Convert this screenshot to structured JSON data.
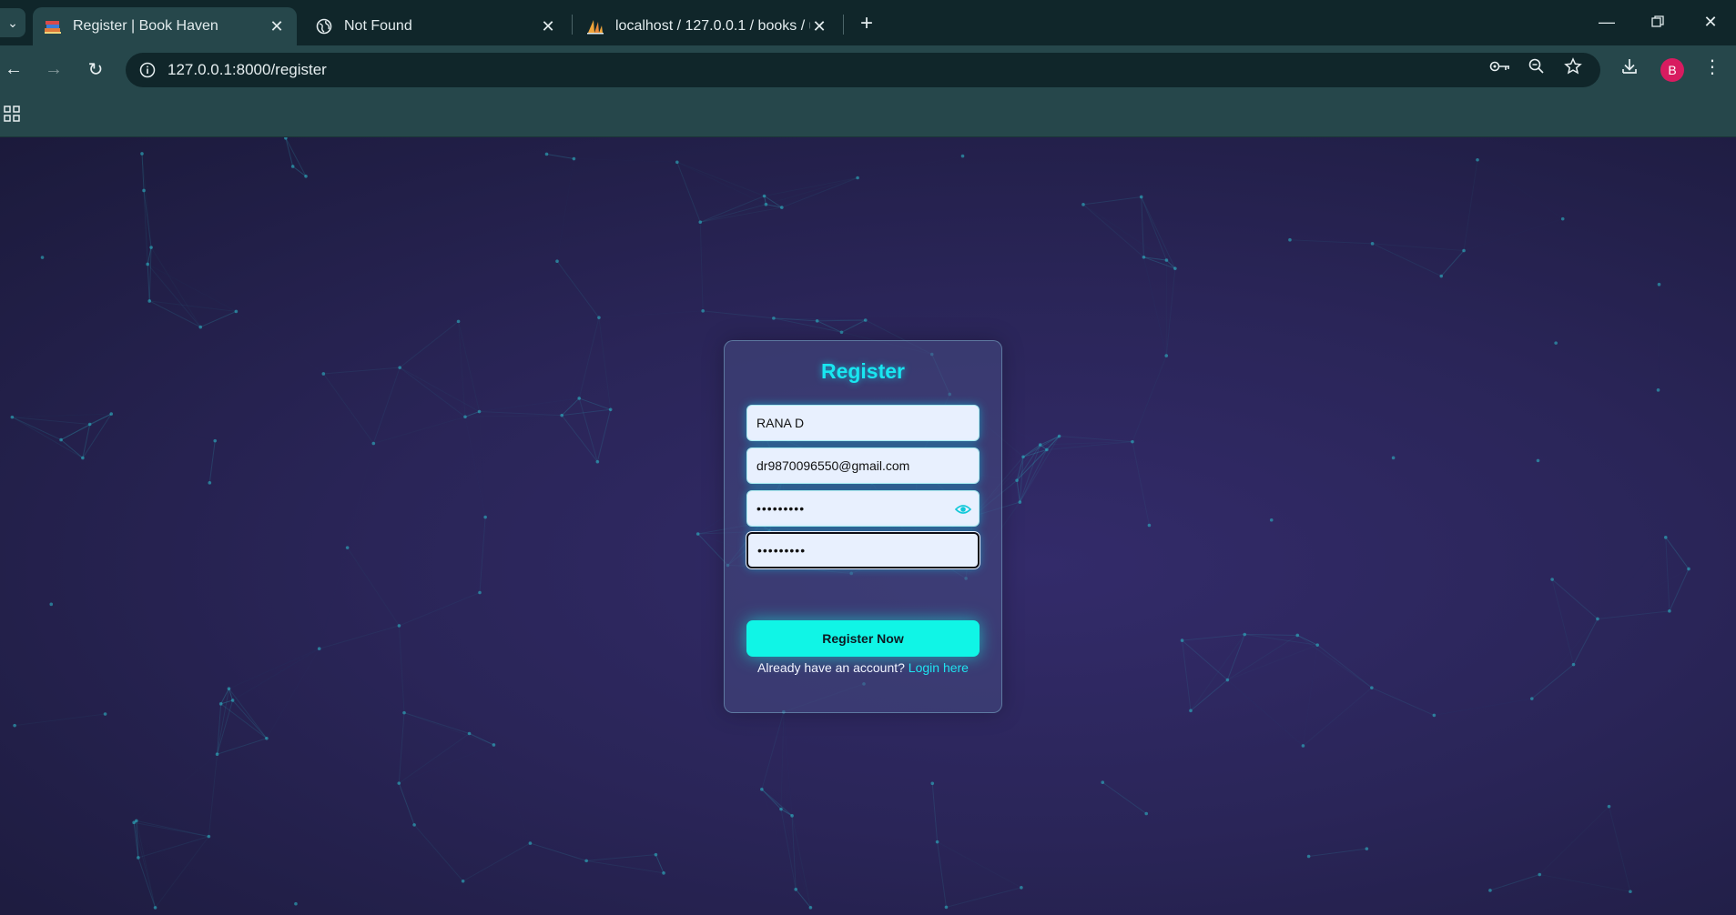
{
  "browser": {
    "tabs": [
      {
        "title": "Register | Book Haven",
        "icon": "books-icon",
        "active": true
      },
      {
        "title": "Not Found",
        "icon": "globe-icon",
        "active": false
      },
      {
        "title": "localhost / 127.0.0.1 / books / u",
        "icon": "phpmyadmin-sail-icon",
        "active": false
      }
    ],
    "url": "127.0.0.1:8000/register",
    "avatar_letter": "B",
    "colors": {
      "tabbar": "#10262a",
      "toolbar": "#26474b",
      "avatar": "#d81b60"
    }
  },
  "form": {
    "title": "Register",
    "name_value": "RANA D",
    "email_value": "dr9870096550@gmail.com",
    "password_value": "•••••••••",
    "confirm_password_value": "•••••••••",
    "submit_label": "Register Now",
    "login_prompt": "Already have an account?",
    "login_link": "Login here",
    "colors": {
      "accent": "#10f5e6",
      "title": "#19e6f0",
      "field_bg": "#e8f0fe"
    }
  }
}
